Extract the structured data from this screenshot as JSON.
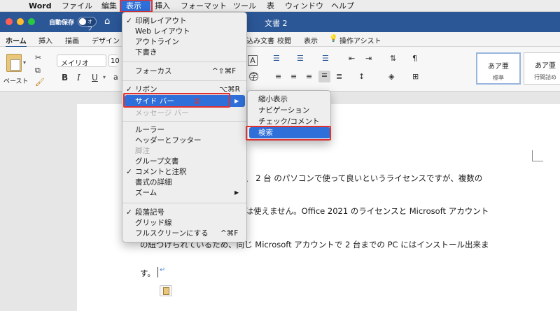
{
  "menubar": {
    "app": "Word",
    "items": [
      "ファイル",
      "編集",
      "表示",
      "挿入",
      "フォーマット",
      "ツール",
      "表",
      "ウィンドウ",
      "ヘルプ"
    ]
  },
  "titlebar": {
    "autosave": "自動保存",
    "toggle": "オフ",
    "doc_title": "文書 2"
  },
  "ribbon_tabs": [
    "ホーム",
    "挿入",
    "描画",
    "デザイン",
    "差し込み文書",
    "校閲",
    "表示",
    "操作アシスト"
  ],
  "ribbon": {
    "paste": "ペースト",
    "font_name": "メイリオ",
    "font_size": "10",
    "bold": "B",
    "italic": "I",
    "underline": "U",
    "style_preview": "あア亜",
    "style1": "標準",
    "style2": "行間詰め"
  },
  "view_menu": {
    "items": [
      {
        "label": "印刷レイアウト",
        "check": "✓",
        "shortcut": ""
      },
      {
        "label": "Web レイアウト",
        "check": "",
        "shortcut": ""
      },
      {
        "label": "アウトライン",
        "check": "",
        "shortcut": ""
      },
      {
        "label": "下書き",
        "check": "",
        "shortcut": ""
      },
      {
        "label": "フォーカス",
        "check": "",
        "shortcut": "^⇧⌘F"
      },
      {
        "label": "リボン",
        "check": "✓",
        "shortcut": "⌥⌘R"
      },
      {
        "label": "サイド バー",
        "check": "",
        "shortcut": "▶"
      },
      {
        "label": "メッセージ バー",
        "check": "",
        "shortcut": ""
      },
      {
        "label": "ルーラー",
        "check": "",
        "shortcut": ""
      },
      {
        "label": "ヘッダーとフッター",
        "check": "",
        "shortcut": ""
      },
      {
        "label": "脚注",
        "check": "",
        "shortcut": ""
      },
      {
        "label": "グループ文書",
        "check": "",
        "shortcut": ""
      },
      {
        "label": "コメントと注釈",
        "check": "✓",
        "shortcut": ""
      },
      {
        "label": "書式の詳細",
        "check": "",
        "shortcut": ""
      },
      {
        "label": "ズーム",
        "check": "",
        "shortcut": "▶"
      },
      {
        "label": "段落記号",
        "check": "✓",
        "shortcut": ""
      },
      {
        "label": "グリッド線",
        "check": "",
        "shortcut": ""
      },
      {
        "label": "フルスクリーンにする",
        "check": "",
        "shortcut": "^⌘F"
      }
    ],
    "badge": "②"
  },
  "sidebar_submenu": [
    "縮小表示",
    "ナビゲーション",
    "チェック/コメント",
    "検索"
  ],
  "document": {
    "line1": "で、 2 台 のパソコンで使って良いというライセンスですが、複数の",
    "line2": "では使えません。Office 2021 のライセンスと Microsoft アカウント",
    "line3": "の紐づけられているため、同じ Microsoft アカウントで 2 台までの PC にはインストール出来ま",
    "line4": "す。",
    "cursor_mark": "↵"
  },
  "colors": {
    "accent": "#2b5797",
    "highlight": "#2f6fd9",
    "annotation": "#e03030"
  }
}
